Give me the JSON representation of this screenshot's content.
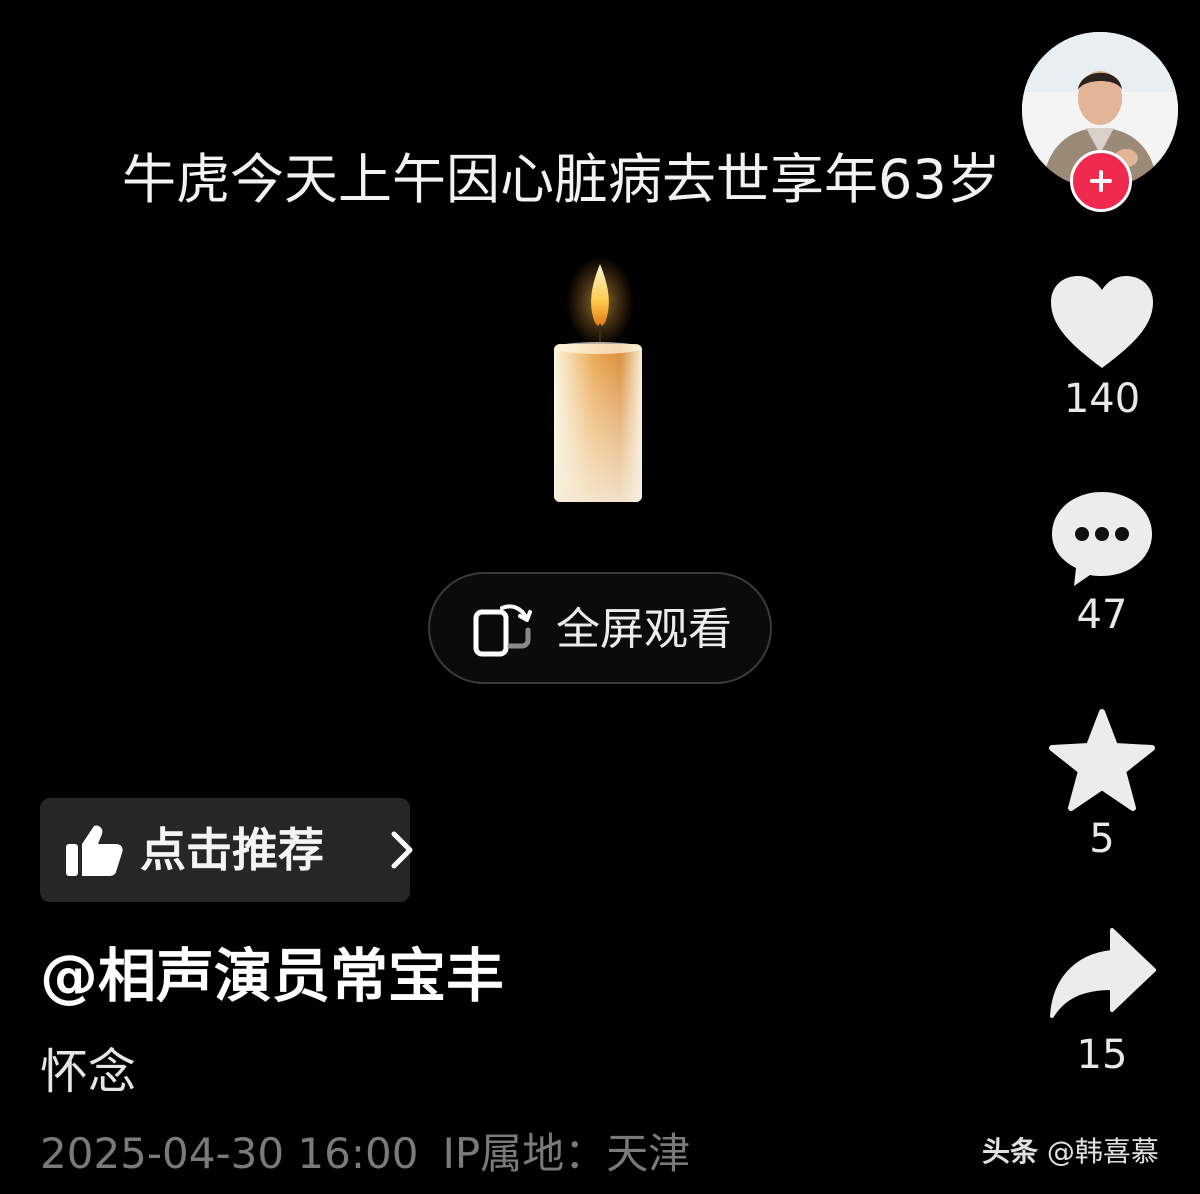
{
  "video": {
    "caption": "牛虎今天上午因心脏病去世享年63岁",
    "fullscreen_label": "全屏观看"
  },
  "sidebar": {
    "likes": "140",
    "comments": "47",
    "favorites": "5",
    "shares": "15"
  },
  "recommend_label": "点击推荐",
  "author": "@相声演员常宝丰",
  "description": "怀念",
  "meta": {
    "date": "2025-04-30 16:00",
    "ip": "IP属地：天津"
  },
  "watermark": {
    "brand": "头条",
    "handle": "@韩喜慕"
  },
  "colors": {
    "background": "#000000",
    "follow_button": "#f0294f",
    "recommend_bg": "#262626"
  }
}
